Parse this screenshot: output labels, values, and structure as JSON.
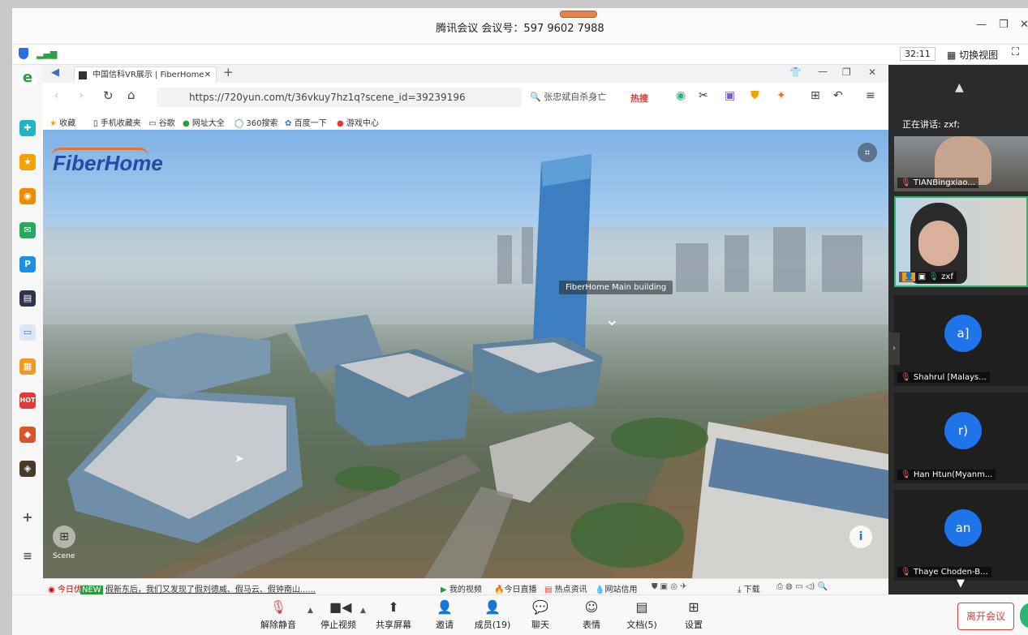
{
  "meeting": {
    "title": "腾讯会议 会议号：597 9602 7988",
    "timer": "32:11",
    "switch_view": "切换视图"
  },
  "browser": {
    "tab_title": "中国信科VR展示 | FiberHome",
    "url": "https://720yun.com/t/36vkuy7hz1q?scene_id=39239196",
    "search_text": "张忠斌自杀身亡",
    "hot_label": "热搜",
    "bookmarks": [
      "收藏",
      "手机收藏夹",
      "谷歌",
      "网址大全",
      "360搜索",
      "百度一下",
      "游戏中心"
    ]
  },
  "vr": {
    "logo": "FiberHome",
    "hotspot_label": "FiberHome Main building",
    "scene_label": "Scene"
  },
  "browser_status": {
    "left": "今日优选",
    "news": "假新东后，我们又发现了假刘德威、假马云、假钟南山......",
    "items": [
      "我的视频",
      "今日直播",
      "热点资讯",
      "网站信用",
      "下载"
    ]
  },
  "panel": {
    "speaking": "正在讲话: zxf;",
    "participants": [
      {
        "name": "TIANBingxiao...",
        "avatar": ""
      },
      {
        "name": "zxf",
        "avatar": ""
      },
      {
        "name": "Shahrul [Malays...",
        "avatar": "a]"
      },
      {
        "name": "Han Htun(Myanm...",
        "avatar": "r)"
      },
      {
        "name": "Thaye Choden-B...",
        "avatar": "an"
      }
    ]
  },
  "toolbar": {
    "unmute": "解除静音",
    "stop_video": "停止视频",
    "share_screen": "共享屏幕",
    "invite": "邀请",
    "members": "成员(19)",
    "chat": "聊天",
    "emoji": "表情",
    "docs": "文档(5)",
    "settings": "设置",
    "leave": "离开会议"
  },
  "colors": {
    "accent_blue": "#1e74e8",
    "leave_red": "#e23c3c"
  }
}
